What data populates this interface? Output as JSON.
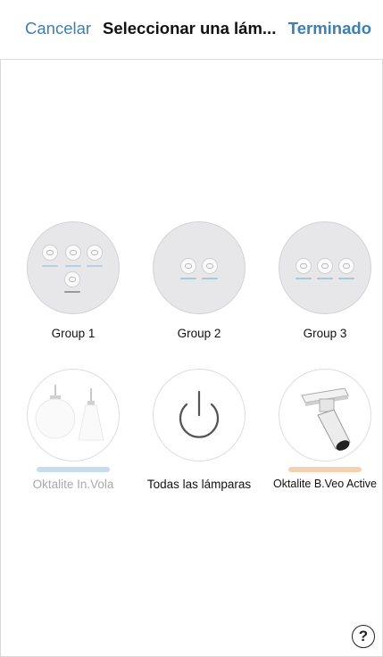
{
  "navbar": {
    "cancel_label": "Cancelar",
    "title": "Seleccionar una lám...",
    "done_label": "Terminado",
    "accent_color": "#3d7fb1"
  },
  "groups": [
    {
      "label": "Group 1",
      "lamps": 4,
      "icon": "group-spot-cluster-icon"
    },
    {
      "label": "Group 2",
      "lamps": 2,
      "icon": "group-spot-cluster-icon"
    },
    {
      "label": "Group 3",
      "lamps": 3,
      "icon": "group-spot-cluster-icon"
    }
  ],
  "lamps": [
    {
      "label": "Oktalite In.Vola",
      "icon": "pendant-lamp-icon",
      "bar_color": "#c7dced",
      "enabled": false
    },
    {
      "label": "Todas las lámparas",
      "icon": "power-icon",
      "bar_color": "",
      "enabled": true
    },
    {
      "label": "Oktalite B.Veo Active",
      "icon": "track-spot-lamp-icon",
      "bar_color": "#f4d2b0",
      "enabled": true
    }
  ],
  "mini_bar_colors": {
    "group1": "#b7cfe0",
    "group1_alt": "#999999",
    "group2": "#a8c8d8",
    "group3": "#a8c8d8"
  },
  "help": {
    "label": "?"
  }
}
